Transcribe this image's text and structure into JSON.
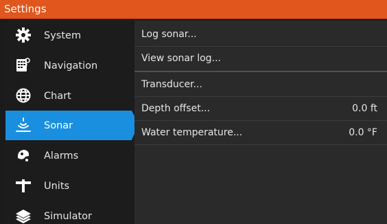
{
  "window": {
    "title": "Settings"
  },
  "sidebar": {
    "items": [
      {
        "label": "System",
        "icon": "gear-icon"
      },
      {
        "label": "Navigation",
        "icon": "navigation-icon"
      },
      {
        "label": "Chart",
        "icon": "globe-icon"
      },
      {
        "label": "Sonar",
        "icon": "sonar-icon",
        "active": true
      },
      {
        "label": "Alarms",
        "icon": "alarm-icon"
      },
      {
        "label": "Units",
        "icon": "units-icon"
      },
      {
        "label": "Simulator",
        "icon": "layers-icon"
      }
    ]
  },
  "sonar_settings": {
    "rows": [
      {
        "label": "Log sonar...",
        "value": ""
      },
      {
        "label": "View sonar log...",
        "value": ""
      },
      {
        "label": "Transducer...",
        "value": ""
      },
      {
        "label": "Depth offset...",
        "value": "0.0 ft"
      },
      {
        "label": "Water temperature...",
        "value": "0.0 °F"
      }
    ]
  },
  "colors": {
    "accent": "#e0561c",
    "selected": "#1a8fe0",
    "panel": "#2a2a2a"
  }
}
